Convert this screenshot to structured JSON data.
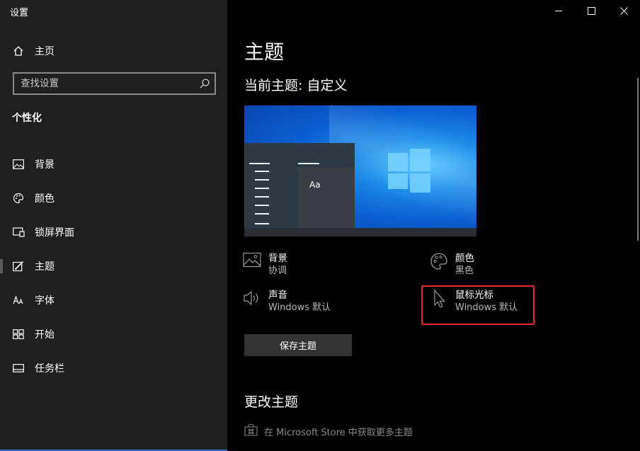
{
  "window": {
    "title": "设置",
    "controls": {
      "minimize_icon": "minimize-icon",
      "maximize_icon": "maximize-icon",
      "close_icon": "close-icon"
    }
  },
  "sidebar": {
    "home_label": "主页",
    "search_placeholder": "查找设置",
    "section_title": "个性化",
    "items": [
      {
        "label": "背景",
        "icon": "picture-icon"
      },
      {
        "label": "颜色",
        "icon": "palette-icon"
      },
      {
        "label": "锁屏界面",
        "icon": "lock-screen-icon"
      },
      {
        "label": "主题",
        "icon": "theme-icon",
        "active": true
      },
      {
        "label": "字体",
        "icon": "font-icon"
      },
      {
        "label": "开始",
        "icon": "start-icon"
      },
      {
        "label": "任务栏",
        "icon": "taskbar-icon"
      }
    ]
  },
  "main": {
    "page_title": "主题",
    "current_theme": "当前主题: 自定义",
    "preview": {
      "sample_text": "Aa"
    },
    "properties": {
      "background": {
        "name": "背景",
        "value": "协调"
      },
      "color": {
        "name": "颜色",
        "value": "黑色"
      },
      "sound": {
        "name": "声音",
        "value": "Windows 默认"
      },
      "cursor": {
        "name": "鼠标光标",
        "value": "Windows 默认"
      }
    },
    "save_button": "保存主题",
    "change_title": "更改主题",
    "store_link": "在 Microsoft Store 中获取更多主题"
  },
  "colors": {
    "sidebar_bg": "#1f1f1f",
    "main_bg": "#000000",
    "highlight": "#e5292a",
    "accent": "#0a78d7"
  }
}
